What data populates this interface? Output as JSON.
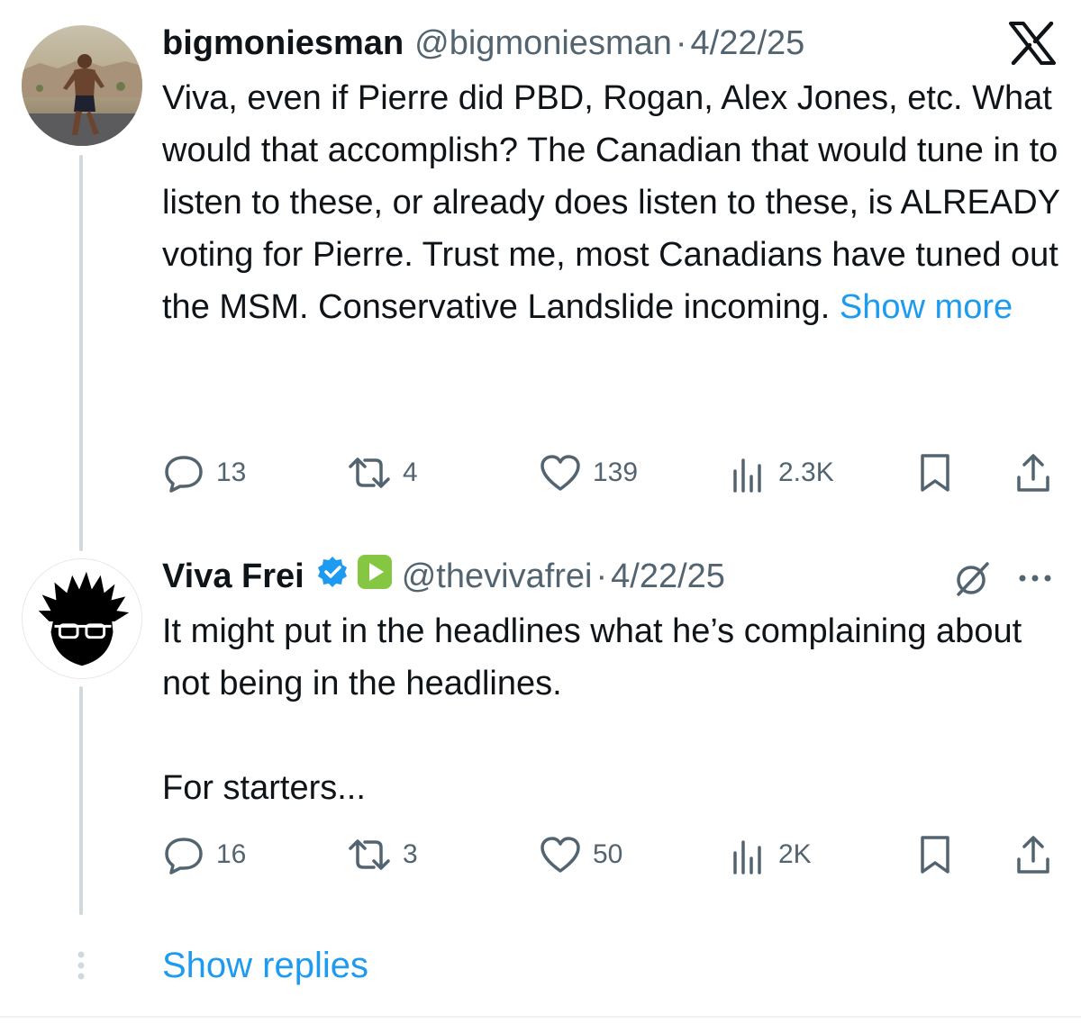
{
  "tweet1": {
    "name": "bigmoniesman",
    "handle": "@bigmoniesman",
    "sep": "·",
    "date": "4/22/25",
    "text": "Viva, even if Pierre did PBD, Rogan, Alex Jones, etc. What would that accomplish? The Canadian that would tune in to listen to these, or already does listen to these, is ALREADY voting for Pierre. Trust me, most Canadians have tuned out the MSM. Conservative Landslide incoming. ",
    "show_more": "Show more",
    "replies": "13",
    "reposts": "4",
    "likes": "139",
    "views": "2.3K",
    "source_icon": "x-logo-icon"
  },
  "tweet2": {
    "name": "Viva Frei",
    "handle": "@thevivafrei",
    "sep": "·",
    "date": "4/22/25",
    "text1": "It might put in the headlines what he’s complaining about not being in the headlines.",
    "text2": "For starters...",
    "replies": "16",
    "reposts": "3",
    "likes": "50",
    "views": "2K",
    "badges": [
      "verified-badge-icon",
      "rumble-icon"
    ]
  },
  "show_replies": "Show replies",
  "colors": {
    "link": "#1d9bf0",
    "muted": "#536471",
    "verified": "#1d9bf0",
    "rumble": "#85c742"
  }
}
